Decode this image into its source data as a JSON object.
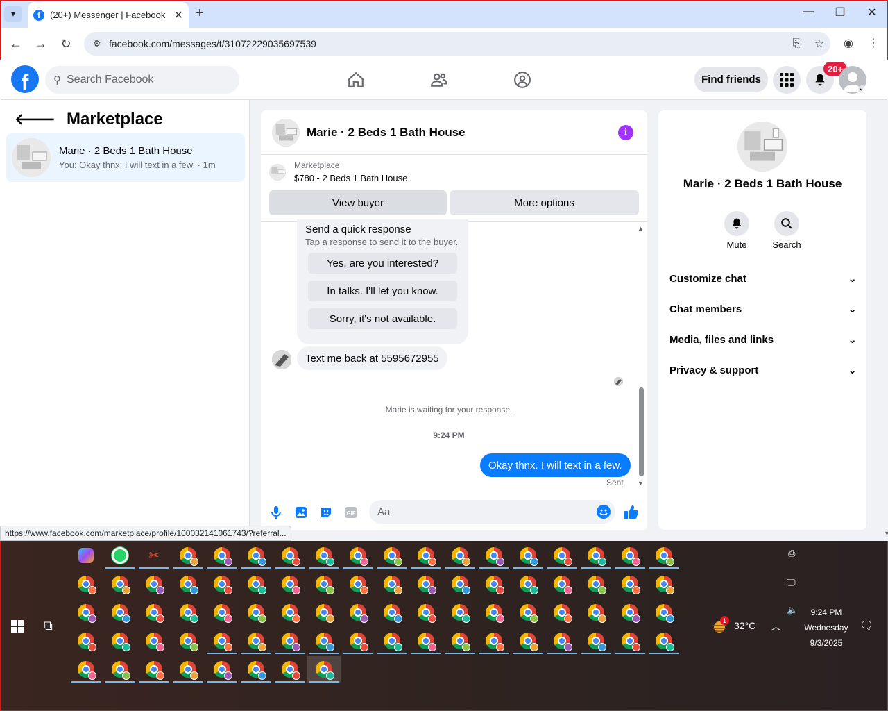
{
  "browser": {
    "tab_title": "(20+) Messenger | Facebook",
    "url": "facebook.com/messages/t/31072229035697539",
    "status_url": "https://www.facebook.com/marketplace/profile/100032141061743/?referral..."
  },
  "fb": {
    "search_placeholder": "Search Facebook",
    "find_friends": "Find friends",
    "notif_badge": "20+"
  },
  "sidebar": {
    "title": "Marketplace",
    "conversation": {
      "name": "Marie · 2 Beds 1 Bath House",
      "preview": "You: Okay thnx. I will text in a few. · 1m"
    }
  },
  "chat": {
    "header_name": "Marie · 2 Beds 1 Bath House",
    "marketplace_label": "Marketplace",
    "listing": "$780 - 2 Beds 1 Bath House",
    "view_buyer": "View buyer",
    "more_options": "More options",
    "quick_title": "Send a quick response",
    "quick_sub": "Tap a response to send it to the buyer.",
    "quick_responses": [
      "Yes, are you interested?",
      "In talks. I'll let you know.",
      "Sorry, it's not available."
    ],
    "incoming_msg": "Text me back at 5595672955",
    "waiting": "Marie is waiting for your response.",
    "time": "9:24 PM",
    "outgoing_msg": "Okay thnx. I will text in a few.",
    "sent": "Sent",
    "composer_placeholder": "Aa"
  },
  "details": {
    "name": "Marie · 2 Beds 1 Bath House",
    "mute": "Mute",
    "search": "Search",
    "sections": [
      "Customize chat",
      "Chat members",
      "Media, files and links",
      "Privacy & support"
    ]
  },
  "taskbar": {
    "temperature": "32°C",
    "weather_badge": "1",
    "time": "9:24 PM",
    "day": "Wednesday",
    "date": "9/3/2025"
  }
}
